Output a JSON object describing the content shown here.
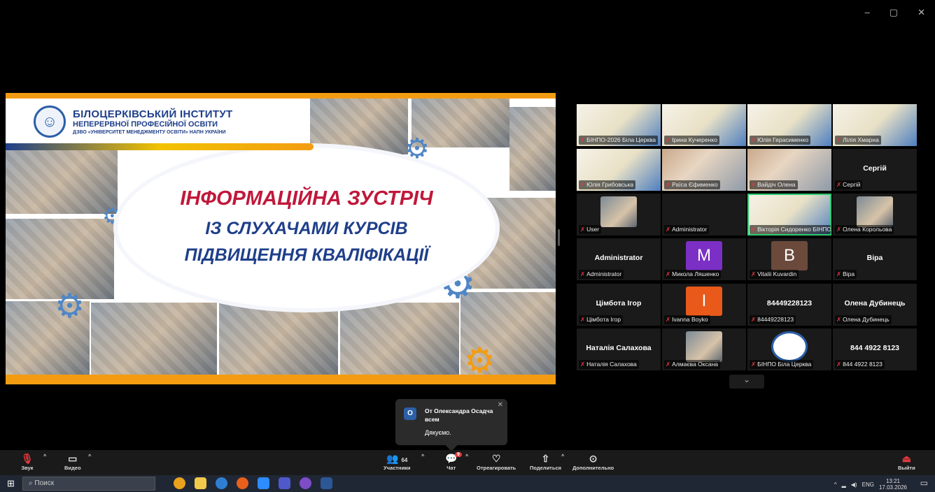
{
  "window": {
    "minimize": "–",
    "restore": "▢",
    "close": "✕"
  },
  "slide": {
    "institute_line1": "БІЛОЦЕРКІВСЬКИЙ ІНСТИТУТ",
    "institute_line2": "НЕПЕРЕРВНОЇ ПРОФЕСІЙНОЇ ОСВІТИ",
    "institute_line3": "ДЗВО «УНІВЕРСИТЕТ МЕНЕДЖМЕНТУ ОСВІТИ» НАПН УКРАЇНИ",
    "title_line1": "ІНФОРМАЦІЙНА ЗУСТРІЧ",
    "title_line2": "ІЗ СЛУХАЧАМИ КУРСІВ",
    "title_line3": "ПІДВИЩЕННЯ КВАЛІФІКАЦІЇ"
  },
  "gallery": {
    "tiles": [
      {
        "name": "БІНПО-2026 Біла Церква"
      },
      {
        "name": "Ірина Кучеренко"
      },
      {
        "name": "Юлія Герасименко"
      },
      {
        "name": "Лілія Хмарна"
      },
      {
        "name": "Юлія Грибовська"
      },
      {
        "name": "Раїса Єфименко"
      },
      {
        "name": "Вайдіч Олена"
      },
      {
        "name": "Сергій",
        "center": "Сергій"
      },
      {
        "name": "User"
      },
      {
        "name": "Administrator"
      },
      {
        "name": "Вікторія Сидоренко БІНПО"
      },
      {
        "name": "Олена Корольова"
      },
      {
        "name": "Administrator",
        "center": "Administrator"
      },
      {
        "name": "Микола Ляшенко",
        "letter": "M"
      },
      {
        "name": "Vitalii Kuvardin",
        "letter": "B"
      },
      {
        "name": "Віра",
        "center": "Віра"
      },
      {
        "name": "Цімбота Ігор",
        "center": "Цімбота Ігор"
      },
      {
        "name": "Ivanna Boyko",
        "letter": "I"
      },
      {
        "name": "84449228123",
        "center": "84449228123"
      },
      {
        "name": "Олена Дубинець",
        "center": "Олена Дубинець"
      },
      {
        "name": "Наталія Салахова",
        "center": "Наталія Салахова"
      },
      {
        "name": "Алмаєва Оксана"
      },
      {
        "name": "БІНПО Біла Церква"
      },
      {
        "name": "844 4922 8123",
        "center": "844 4922 8123"
      }
    ],
    "scroll_down": "⌄"
  },
  "toast": {
    "avatar_letter": "O",
    "from": "От Олександра Осадча всем",
    "message": "Дякуємо.",
    "close": "✕"
  },
  "toolbar": {
    "audio_label": "Звук",
    "video_label": "Видео",
    "participants_label": "Участники",
    "participants_count": "64",
    "chat_label": "Чат",
    "chat_badge": "9",
    "react_label": "Отреагировать",
    "share_label": "Поделиться",
    "more_label": "Дополнительно",
    "leave_label": "Выйти"
  },
  "taskbar": {
    "search_placeholder": "Поиск",
    "lang": "ENG",
    "time": "13:21",
    "date": "17.03.2026"
  },
  "colors": {
    "accent_orange": "#f39c12",
    "title_red": "#c0183b",
    "title_blue": "#1f3f8a",
    "mic_muted": "#e0393e",
    "avatar_purple": "#7b2fc4",
    "avatar_brown": "#6b4a3c",
    "avatar_orange": "#e8591a"
  }
}
